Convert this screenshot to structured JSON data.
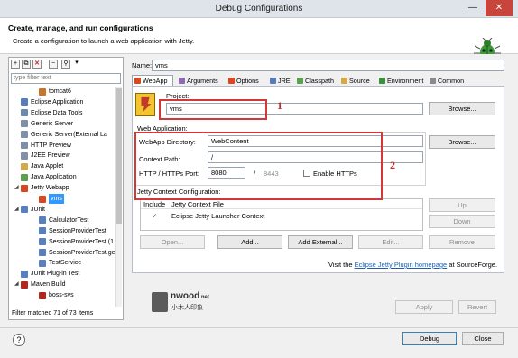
{
  "window": {
    "title": "Debug Configurations",
    "minimize": "—",
    "close": "✕"
  },
  "header": {
    "title": "Create, manage, and run configurations",
    "subtitle": "Create a configuration to launch a web application with Jetty."
  },
  "left": {
    "filter_placeholder": "type filter text",
    "tree": [
      {
        "label": "tomcat6",
        "indent": 2,
        "color": "#c8742a"
      },
      {
        "label": "Eclipse Application",
        "indent": 1,
        "color": "#5b7bbf"
      },
      {
        "label": "Eclipse Data Tools",
        "indent": 1,
        "color": "#6a8ab0"
      },
      {
        "label": "Generic Server",
        "indent": 1,
        "color": "#7f8fa8"
      },
      {
        "label": "Generic Server(External La",
        "indent": 1,
        "color": "#7f8fa8"
      },
      {
        "label": "HTTP Preview",
        "indent": 1,
        "color": "#7f8fa8"
      },
      {
        "label": "J2EE Preview",
        "indent": 1,
        "color": "#7f8fa8"
      },
      {
        "label": "Java Applet",
        "indent": 1,
        "color": "#d2a94c"
      },
      {
        "label": "Java Application",
        "indent": 1,
        "color": "#5ca04f"
      },
      {
        "label": "Jetty Webapp",
        "indent": 1,
        "color": "#d9471f",
        "expanded": true
      },
      {
        "label": "vms",
        "indent": 2,
        "color": "#d9471f",
        "selected": true
      },
      {
        "label": "JUnit",
        "indent": 1,
        "color": "#5a7fbf",
        "expanded": true,
        "prefix": "Ju"
      },
      {
        "label": "CalculatorTest",
        "indent": 2,
        "color": "#5a7fbf",
        "prefix": "Ju"
      },
      {
        "label": "SessionProviderTest",
        "indent": 2,
        "color": "#5a7fbf",
        "prefix": "Ju"
      },
      {
        "label": "SessionProviderTest (1",
        "indent": 2,
        "color": "#5a7fbf",
        "prefix": "Ju"
      },
      {
        "label": "SessionProviderTest.ge",
        "indent": 2,
        "color": "#5a7fbf",
        "prefix": "Ju"
      },
      {
        "label": "TestService",
        "indent": 2,
        "color": "#5a7fbf",
        "prefix": "Ju"
      },
      {
        "label": "JUnit Plug-in Test",
        "indent": 1,
        "color": "#5a7fbf"
      },
      {
        "label": "Maven Build",
        "indent": 1,
        "color": "#b3261e",
        "expanded": true,
        "prefix": "m2"
      },
      {
        "label": "boss-svs",
        "indent": 2,
        "color": "#b3261e",
        "prefix": "m2"
      }
    ],
    "status": "Filter matched 71 of 73 items"
  },
  "config": {
    "name_label": "Name:",
    "name_value": "vms",
    "tabs": [
      "WebApp",
      "Arguments",
      "Options",
      "JRE",
      "Classpath",
      "Source",
      "Environment",
      "Common"
    ],
    "project_label": "Project:",
    "project_value": "vms",
    "browse1": "Browse...",
    "webapp_group": "Web Application:",
    "webapp_dir_label": "WebApp Directory:",
    "webapp_dir_value": "WebContent",
    "browse2": "Browse...",
    "context_path_label": "Context Path:",
    "context_path_value": "/",
    "port_label": "HTTP / HTTPs Port:",
    "http_port": "8080",
    "port_sep": "/",
    "https_port": "8443",
    "enable_https": "Enable HTTPs",
    "jetty_ctx_label": "Jetty Context Configuration:",
    "table_headers": [
      "Include",
      "Jetty Context File"
    ],
    "table_rows": [
      {
        "check": "✓",
        "file": "Eclipse Jetty Launcher Context"
      }
    ],
    "up": "Up",
    "down": "Down",
    "remove": "Remove",
    "open": "Open...",
    "add": "Add...",
    "add_external": "Add External...",
    "edit": "Edit...",
    "visit_prefix": "Visit the ",
    "visit_link": "Eclipse Jetty Plugin homepage",
    "visit_suffix": " at SourceForge.",
    "apply": "Apply",
    "revert": "Revert",
    "annotation1": "1",
    "annotation2": "2"
  },
  "watermark": {
    "line1": "nwood",
    "line1_suffix": ".net",
    "line2": "小木人印象"
  },
  "footer": {
    "help": "?",
    "debug": "Debug",
    "close": "Close"
  },
  "colors": {
    "annotation": "#d33838",
    "link": "#1a5fb4",
    "selection": "#3399ff"
  }
}
